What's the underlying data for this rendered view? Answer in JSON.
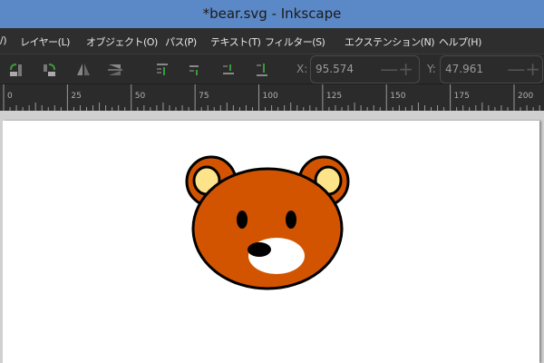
{
  "window": {
    "title": "*bear.svg - Inkscape"
  },
  "menu": [
    "/)",
    "レイヤー(L)",
    "オブジェクト(O)",
    "パス(P)",
    "テキスト(T)",
    "フィルター(S)",
    "エクステンション(N)",
    "ヘルプ(H)"
  ],
  "toolbar": {
    "x_label": "X:",
    "x_value": "95.574",
    "y_label": "Y:",
    "y_value": "47.961",
    "plus_minus": "—+"
  },
  "ruler": {
    "ticks": [
      "0",
      "25",
      "50",
      "75",
      "100",
      "125",
      "150",
      "175",
      "200"
    ]
  },
  "colors": {
    "fur": "#d35400",
    "ear_inner": "#fde38a",
    "muzzle": "#ffffff",
    "outline": "#000000"
  }
}
